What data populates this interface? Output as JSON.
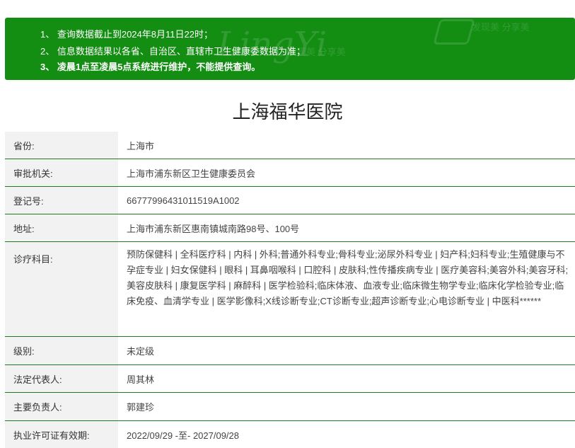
{
  "notice": {
    "items": [
      "1、 查询数据截止到2024年8月11日22时；",
      "2、 信息数据结果以各省、自治区、直辖市卫生健康委数据为准；",
      "3、 凌晨1点至凌晨5点系统进行维护，不能提供查询。"
    ],
    "watermark_text": "LingYi",
    "watermark_slogan": "发现美 分享美",
    "background_color": "#138e13"
  },
  "hospital": {
    "name": "上海福华医院"
  },
  "fields": [
    {
      "label": "省份:",
      "value": "上海市"
    },
    {
      "label": "审批机关:",
      "value": "上海市浦东新区卫生健康委员会"
    },
    {
      "label": "登记号:",
      "value": "66777996431011519A1002"
    },
    {
      "label": "地址:",
      "value": "上海市浦东新区惠南镇城南路98号、100号"
    },
    {
      "label": "诊疗科目:",
      "value": "预防保健科 | 全科医疗科 | 内科 | 外科;普通外科专业;骨科专业;泌尿外科专业 | 妇产科;妇科专业;生殖健康与不孕症专业 | 妇女保健科 | 眼科 | 耳鼻咽喉科 | 口腔科 | 皮肤科;性传播疾病专业 | 医疗美容科;美容外科;美容牙科;美容皮肤科 | 康复医学科 | 麻醉科 | 医学检验科;临床体液、血液专业;临床微生物学专业;临床化学检验专业;临床免疫、血清学专业 | 医学影像科;X线诊断专业;CT诊断专业;超声诊断专业;心电诊断专业 | 中医科******"
    },
    {
      "label": "级别:",
      "value": "未定级"
    },
    {
      "label": "法定代表人:",
      "value": "周其林"
    },
    {
      "label": "主要负责人:",
      "value": "郭建珍"
    },
    {
      "label": "执业许可证有效期:",
      "value": "2022/09/29 -至- 2027/09/28"
    }
  ]
}
